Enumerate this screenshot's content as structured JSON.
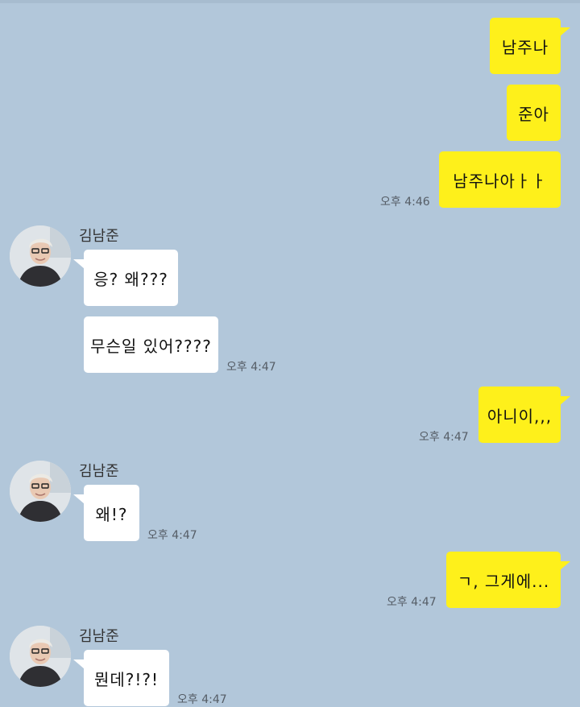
{
  "contact": {
    "name": "김남준"
  },
  "messages": [
    {
      "side": "me",
      "text": "남주나"
    },
    {
      "side": "me",
      "text": "준아"
    },
    {
      "side": "me",
      "text": "남주나아ㅏㅏ",
      "time": "오후 4:46"
    },
    {
      "side": "them",
      "text": "응? 왜???"
    },
    {
      "side": "them",
      "text": "무슨일 있어????",
      "time": "오후 4:47"
    },
    {
      "side": "me",
      "text": "아니이,,,",
      "time": "오후 4:47"
    },
    {
      "side": "them",
      "text": "왜!?",
      "time": "오후 4:47"
    },
    {
      "side": "me",
      "text": "ㄱ, 그게에...",
      "time": "오후 4:47"
    },
    {
      "side": "them",
      "text": "뭔데?!?!",
      "time": "오후 4:47"
    }
  ],
  "colors": {
    "background": "#b2c7da",
    "my_bubble": "#fef01b",
    "their_bubble": "#ffffff"
  }
}
